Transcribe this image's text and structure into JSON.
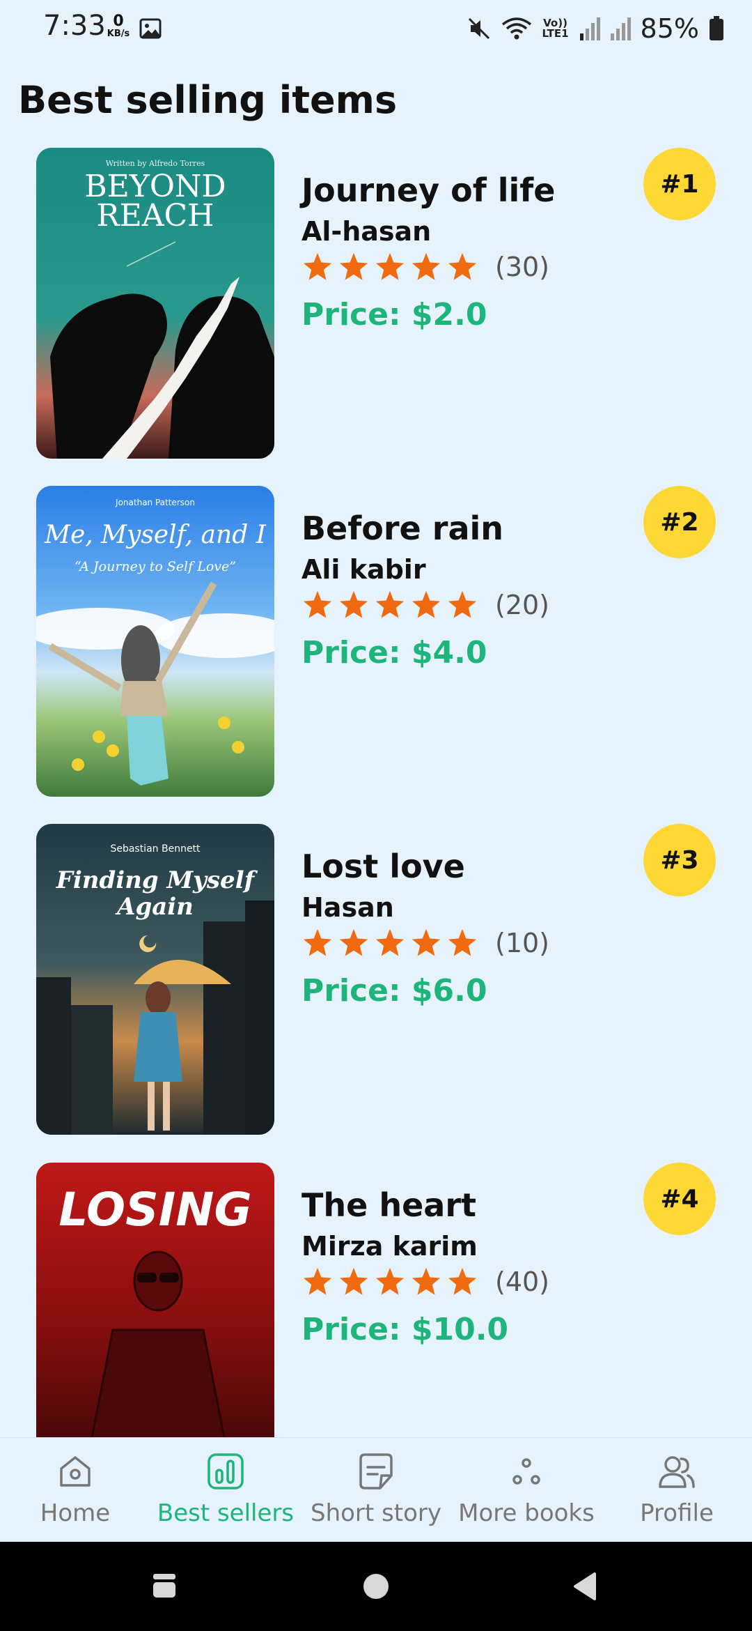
{
  "status_bar": {
    "time": "7:33",
    "net_speed_value": "0",
    "net_speed_unit": "KB/s",
    "battery": "85%",
    "icons": [
      "gallery-icon",
      "mute-icon",
      "wifi-icon",
      "volte-icon",
      "signal-icon",
      "signal-icon",
      "battery-icon"
    ],
    "volte_text_top": "Vo))",
    "volte_text_bottom": "LTE1"
  },
  "page_title": "Best selling items",
  "books": [
    {
      "rank": "#1",
      "title": "Journey of life",
      "author": "Al-hasan",
      "stars": 5,
      "rating_count": "(30)",
      "price": "Price: $2.0",
      "cover_author": "Written by Alfredo Torres",
      "cover_title_1": "BEYOND",
      "cover_title_2": "REACH"
    },
    {
      "rank": "#2",
      "title": "Before rain",
      "author": "Ali kabir",
      "stars": 5,
      "rating_count": "(20)",
      "price": "Price: $4.0",
      "cover_author": "Jonathan Patterson",
      "cover_title_1": "Me, Myself, and I",
      "cover_title_2": "“A Journey to Self Love”"
    },
    {
      "rank": "#3",
      "title": "Lost love",
      "author": "Hasan",
      "stars": 5,
      "rating_count": "(10)",
      "price": "Price: $6.0",
      "cover_author": "Sebastian Bennett",
      "cover_title_1": "Finding Myself",
      "cover_title_2": "Again"
    },
    {
      "rank": "#4",
      "title": "The heart",
      "author": "Mirza karim",
      "stars": 5,
      "rating_count": "(40)",
      "price": "Price: $10.0",
      "cover_author": "",
      "cover_title_1": "LOSING",
      "cover_title_2": ""
    }
  ],
  "bottom_nav": {
    "items": [
      {
        "label": "Home",
        "icon": "home-icon"
      },
      {
        "label": "Best sellers",
        "icon": "chart-icon",
        "active": true
      },
      {
        "label": "Short story",
        "icon": "note-icon"
      },
      {
        "label": "More books",
        "icon": "dots-icon"
      },
      {
        "label": "Profile",
        "icon": "users-icon"
      }
    ]
  },
  "colors": {
    "background": "#e6f2fc",
    "accent": "#1eb57a",
    "star": "#f26a0f",
    "badge": "#fdd835"
  }
}
